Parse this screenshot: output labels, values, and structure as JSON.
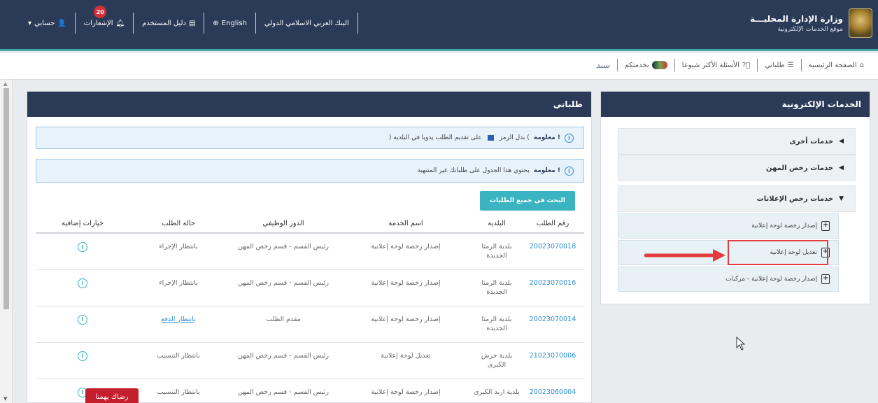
{
  "header": {
    "ministry_title": "وزارة الإدارة المحليـــة",
    "ministry_subtitle": "موقع الخدمات الإلكترونية",
    "bank_label": "البنك العربي الاسلامي الدولي",
    "language_label": "English",
    "user_guide_label": "دليل المستخدم",
    "notifications_label": "الإشعارات",
    "notifications_count": "20",
    "account_label": "حسابي"
  },
  "subnav": {
    "home": "الصفحة الرئيسية",
    "my_requests": "طلباتي",
    "faq": "الأسئلة الأكثر شيوعا",
    "at_your_service": "بخدمتكم",
    "sanad": "سند"
  },
  "sidebar": {
    "title": "الخدمات الإلكترونية",
    "groups": [
      {
        "label": "خدمات أخرى",
        "expanded": false
      },
      {
        "label": "خدمات رخص المهن",
        "expanded": false
      },
      {
        "label": "خدمات رخص الإعلانات",
        "expanded": true
      }
    ],
    "services": [
      {
        "label": "إصدار رخصة لوحة إعلانية"
      },
      {
        "label": "تعديل لوحة إعلانية"
      },
      {
        "label": "إصدار رخصة لوحة إعلانية - مركبات"
      }
    ]
  },
  "main": {
    "title": "طلباتي",
    "info1_bold": "معلومة !",
    "info1_text_a": "بدل الرمز (",
    "info1_text_b": ") على تقديم الطلب يدويا في البلدية",
    "info2_bold": "معلومة !",
    "info2_text": "يحتوي هذا الجدول على طلباتك غير المنتهية",
    "search_button": "البحث في جميع الطلبات",
    "columns": [
      "رقم الطلب",
      "البلدية",
      "اسم الخدمة",
      "الدور الوظيفي",
      "حالة الطلب",
      "خيارات إضافية"
    ],
    "rows": [
      {
        "id": "20023070018",
        "municipality": "بلدية الرمثا الجديدة",
        "service": "إصدار رخصة لوحة إعلانية",
        "role": "رئيس القسم - قسم رخص المهن",
        "status": "بانتظار الإجراء"
      },
      {
        "id": "20023070016",
        "municipality": "بلدية الرمثا الجديدة",
        "service": "إصدار رخصة لوحة إعلانية",
        "role": "رئيس القسم - قسم رخص المهن",
        "status": "بانتظار الإجراء"
      },
      {
        "id": "20023070014",
        "municipality": "بلدية الرمثا الجديدة",
        "service": "إصدار رخصة لوحة إعلانية",
        "role": "مقدم الطلب",
        "status": "بانتظار الدفع"
      },
      {
        "id": "21023070006",
        "municipality": "بلدية جرش الكبرى",
        "service": "تعديل لوحة إعلانية",
        "role": "رئيس القسم - قسم رخص المهن",
        "status": "بانتظار التنسيب"
      },
      {
        "id": "20023060004",
        "municipality": "بلدية اربد الكبرى",
        "service": "إصدار رخصة لوحة إعلانية",
        "role": "رئيس القسم - قسم رخص المهن",
        "status": "بانتظار التنسيب"
      }
    ]
  },
  "feedback_label": "رضاك يهمنا",
  "colors": {
    "header": "#2b3a57",
    "accent": "#3bb4c1",
    "highlight": "#e23c3c"
  }
}
